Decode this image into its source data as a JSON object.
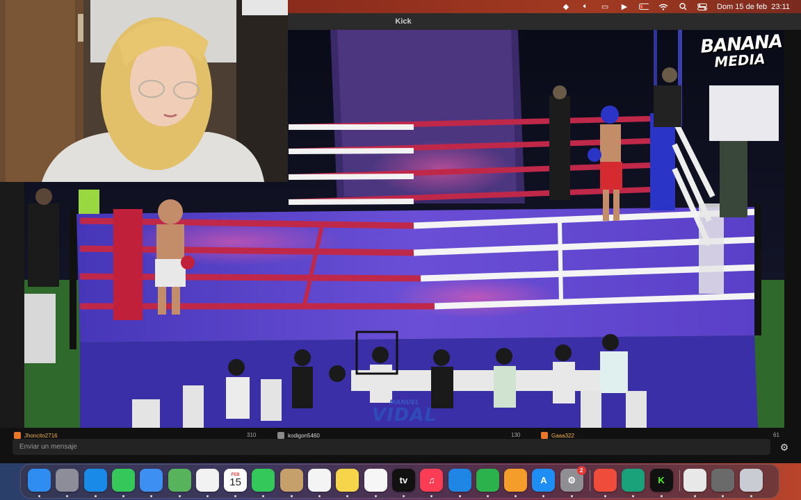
{
  "menubar": {
    "clock": "Dom 15 de feb  23:11",
    "icons": [
      "klack-icon",
      "volume-icon",
      "screen-mirror-icon",
      "play-icon",
      "battery-icon",
      "wifi-icon",
      "spotlight-icon",
      "control-center-icon"
    ]
  },
  "window": {
    "title": "Kick"
  },
  "stream": {
    "logo_line1": "BANANA",
    "logo_line2": "MEDIA",
    "watermark_small": "MANUEL",
    "watermark_large": "VIDAL"
  },
  "leaderboard": [
    {
      "name": "Jhoncito2716",
      "count": "310",
      "badge_color": "#e8772a"
    },
    {
      "name": "kodigon5460",
      "count": "130",
      "badge_color": "#8a8a8a"
    },
    {
      "name": "Gaaa322",
      "count": "61",
      "badge_color": "#e8772a"
    }
  ],
  "chat": {
    "placeholder": "Enviar un mensaje"
  },
  "dock": {
    "items": [
      {
        "name": "finder",
        "label": "",
        "color": "#2f8cf0"
      },
      {
        "name": "launchpad",
        "label": "",
        "color": "#8d8d9a"
      },
      {
        "name": "safari",
        "label": "",
        "color": "#1a8ae8"
      },
      {
        "name": "messages",
        "label": "",
        "color": "#35c75a"
      },
      {
        "name": "mail",
        "label": "",
        "color": "#3d8ff2"
      },
      {
        "name": "maps",
        "label": "",
        "color": "#57b45c"
      },
      {
        "name": "photos",
        "label": "",
        "color": "#f2f2f2"
      },
      {
        "name": "calendar",
        "label": "15",
        "month": "FEB",
        "color": "#ffffff"
      },
      {
        "name": "facetime",
        "label": "",
        "color": "#34c759"
      },
      {
        "name": "contacts",
        "label": "",
        "color": "#c6a06a"
      },
      {
        "name": "reminders",
        "label": "",
        "color": "#f4f4f4"
      },
      {
        "name": "notes",
        "label": "",
        "color": "#f7d54a"
      },
      {
        "name": "freeform",
        "label": "",
        "color": "#f6f6f6"
      },
      {
        "name": "apple-tv",
        "label": "tv",
        "color": "#111111"
      },
      {
        "name": "music",
        "label": "♫",
        "color": "#fa3c54"
      },
      {
        "name": "keynote",
        "label": "",
        "color": "#1f86e6"
      },
      {
        "name": "numbers",
        "label": "",
        "color": "#2bb24c"
      },
      {
        "name": "pages",
        "label": "",
        "color": "#f59d2a"
      },
      {
        "name": "app-store",
        "label": "A",
        "color": "#1e8ef5"
      },
      {
        "name": "system-settings",
        "label": "⚙",
        "color": "#8e8e93",
        "badge": "2"
      },
      {
        "name": "anydesk",
        "label": "",
        "color": "#ef4c3b"
      },
      {
        "name": "android-studio",
        "label": "",
        "color": "#1aa37a"
      },
      {
        "name": "kick",
        "label": "K",
        "color": "#111111"
      },
      {
        "name": "downloads-stack",
        "label": "",
        "color": "#e8e8e8"
      },
      {
        "name": "recent-window",
        "label": "",
        "color": "#6a6a6a"
      },
      {
        "name": "trash",
        "label": "",
        "color": "#c9ccd2"
      }
    ]
  }
}
